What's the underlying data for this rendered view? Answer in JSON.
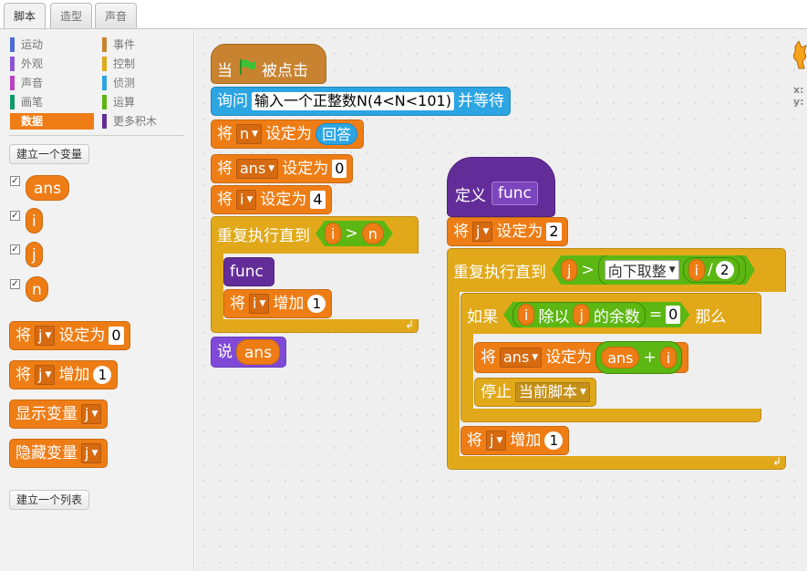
{
  "tabs": [
    "脚本",
    "造型",
    "声音"
  ],
  "categories": {
    "left": [
      {
        "label": "运动",
        "color": "#4a6cd4"
      },
      {
        "label": "外观",
        "color": "#8a55d7"
      },
      {
        "label": "声音",
        "color": "#bb42c3"
      },
      {
        "label": "画笔",
        "color": "#0e9a6c"
      },
      {
        "label": "数据",
        "color": "#ee7d16"
      }
    ],
    "right": [
      {
        "label": "事件",
        "color": "#c88330"
      },
      {
        "label": "控制",
        "color": "#e1a91a"
      },
      {
        "label": "侦测",
        "color": "#2ca5e2"
      },
      {
        "label": "运算",
        "color": "#5cb712"
      },
      {
        "label": "更多积木",
        "color": "#632d99"
      }
    ]
  },
  "palette": {
    "make_variable": "建立一个变量",
    "variables": [
      "ans",
      "i",
      "j",
      "n"
    ],
    "set_block": {
      "prefix": "将",
      "var": "j",
      "middle": "设定为",
      "value": "0"
    },
    "change_block": {
      "prefix": "将",
      "var": "j",
      "middle": "增加",
      "value": "1"
    },
    "show_block": {
      "label": "显示变量",
      "var": "j"
    },
    "hide_block": {
      "label": "隐藏变量",
      "var": "j"
    },
    "make_list": "建立一个列表"
  },
  "script_main": {
    "when_flag": {
      "prefix": "当",
      "suffix": "被点击"
    },
    "ask": {
      "label": "询问",
      "question": "输入一个正整数N(4<N<101)",
      "suffix": "并等待"
    },
    "set_n": {
      "prefix": "将",
      "var": "n",
      "middle": "设定为",
      "reporter": "回答"
    },
    "set_ans": {
      "prefix": "将",
      "var": "ans",
      "middle": "设定为",
      "value": "0"
    },
    "set_i": {
      "prefix": "将",
      "var": "i",
      "middle": "设定为",
      "value": "4"
    },
    "repeat_until": {
      "label": "重复执行直到",
      "left": "i",
      "op": ">",
      "right": "n"
    },
    "call_func": "func",
    "change_i": {
      "prefix": "将",
      "var": "i",
      "middle": "增加",
      "value": "1"
    },
    "say": {
      "label": "说",
      "reporter": "ans"
    }
  },
  "script_func": {
    "define": {
      "label": "定义",
      "name": "func"
    },
    "set_j": {
      "prefix": "将",
      "var": "j",
      "middle": "设定为",
      "value": "2"
    },
    "repeat_until": {
      "label": "重复执行直到",
      "left": "j",
      "op": ">",
      "round_label": "向下取整",
      "div_left": "i",
      "div_op": "/",
      "div_right": "2"
    },
    "if_block": {
      "label": "如果",
      "left": "i",
      "mod_label": "除以",
      "mid": "j",
      "mod_suffix": "的余数",
      "eq": "=",
      "value": "0",
      "then": "那么"
    },
    "set_ans": {
      "prefix": "将",
      "var": "ans",
      "middle": "设定为",
      "left": "ans",
      "op": "+",
      "right": "i"
    },
    "stop": {
      "label": "停止",
      "option": "当前脚本"
    },
    "change_j": {
      "prefix": "将",
      "var": "j",
      "middle": "增加",
      "value": "1"
    }
  },
  "sprite_info": {
    "x_label": "x:",
    "y_label": "y:"
  }
}
